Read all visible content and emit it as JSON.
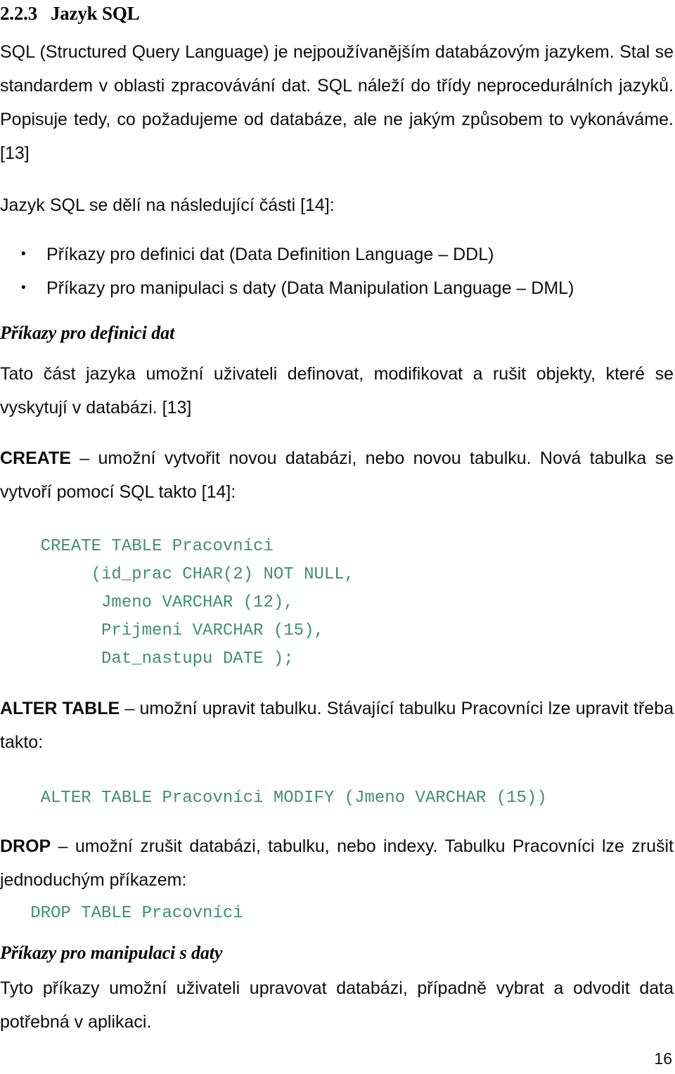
{
  "document": {
    "language": "cs",
    "page_number": "16",
    "text_color": "#0d0d0d",
    "code_color": "#3f9070",
    "background": "#ffffff"
  },
  "section": {
    "number": "2.2.3",
    "title": "Jazyk SQL"
  },
  "intro_paragraph": "SQL (Structured Query Language) je nejpoužívanějším databázovým jazykem. Stal se standardem v oblasti zpracovávání dat. SQL náleží do třídy neprocedurálních jazyků. Popisuje tedy, co požadujeme od databáze, ale ne jakým způsobem to vykonáváme. [13]",
  "parts_lead": "Jazyk SQL se dělí na následující části [14]:",
  "bullets": [
    {
      "marker": "•",
      "text": "Příkazy pro definici dat (Data Definition Language – DDL)"
    },
    {
      "marker": "•",
      "text": "Příkazy pro manipulaci s daty (Data Manipulation Language – DML)"
    }
  ],
  "ddl": {
    "heading": "Příkazy pro definici dat",
    "description": "Tato část jazyka umožní uživateli definovat, modifikovat a rušit objekty, které se vyskytují v databázi. [13]",
    "create": {
      "keyword": "CREATE",
      "text": " – umožní vytvořit novou databázi, nebo novou tabulku. Nová tabulka se vytvoří pomocí SQL takto [14]:",
      "code": "    CREATE TABLE Pracovníci\n         (id_prac CHAR(2) NOT NULL,\n          Jmeno VARCHAR (12),\n          Prijmeni VARCHAR (15),\n          Dat_nastupu DATE );"
    },
    "alter": {
      "keyword": "ALTER TABLE",
      "text": " – umožní upravit tabulku. Stávající tabulku Pracovníci lze upravit třeba takto:",
      "code": "    ALTER TABLE Pracovníci MODIFY (Jmeno VARCHAR (15))"
    },
    "drop": {
      "keyword": "DROP",
      "text": " – umožní zrušit databázi, tabulku, nebo indexy. Tabulku Pracovníci lze zrušit jednoduchým příkazem:",
      "code": "   DROP TABLE Pracovníci"
    }
  },
  "dml": {
    "heading": "Příkazy pro manipulaci s daty",
    "description": "Tyto příkazy umožní uživateli upravovat databázi, případně vybrat a odvodit data potřebná v aplikaci."
  }
}
